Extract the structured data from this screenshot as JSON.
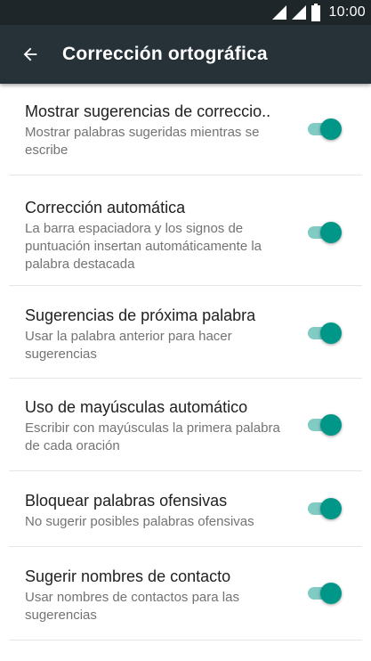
{
  "status_bar": {
    "time": "10:00",
    "icons": [
      "signal-icon",
      "signal-icon",
      "battery-icon"
    ]
  },
  "app_bar": {
    "back_icon": "arrow-back-icon",
    "title": "Corrección ortográfica"
  },
  "settings": [
    {
      "title": "Mostrar sugerencias de correccio..",
      "summary": "Mostrar palabras sugeridas mientras se escribe",
      "enabled": true
    },
    {
      "title": "Corrección automática",
      "summary": "La barra espaciadora y los signos de puntuación insertan automáticamente la palabra destacada",
      "enabled": true
    },
    {
      "title": "Sugerencias de próxima palabra",
      "summary": "Usar la palabra anterior para hacer sugerencias",
      "enabled": true
    },
    {
      "title": "Uso de mayúsculas automático",
      "summary": "Escribir con mayúsculas la primera palabra de cada oración",
      "enabled": true
    },
    {
      "title": "Bloquear palabras ofensivas",
      "summary": "No sugerir posibles palabras ofensivas",
      "enabled": true
    },
    {
      "title": "Sugerir nombres de contacto",
      "summary": "Usar nombres de contactos para las sugerencias",
      "enabled": true
    }
  ],
  "colors": {
    "status_bar": "#1f2629",
    "app_bar": "#263238",
    "switch_thumb_on": "#009688",
    "switch_track_on": "#80cbc4"
  }
}
